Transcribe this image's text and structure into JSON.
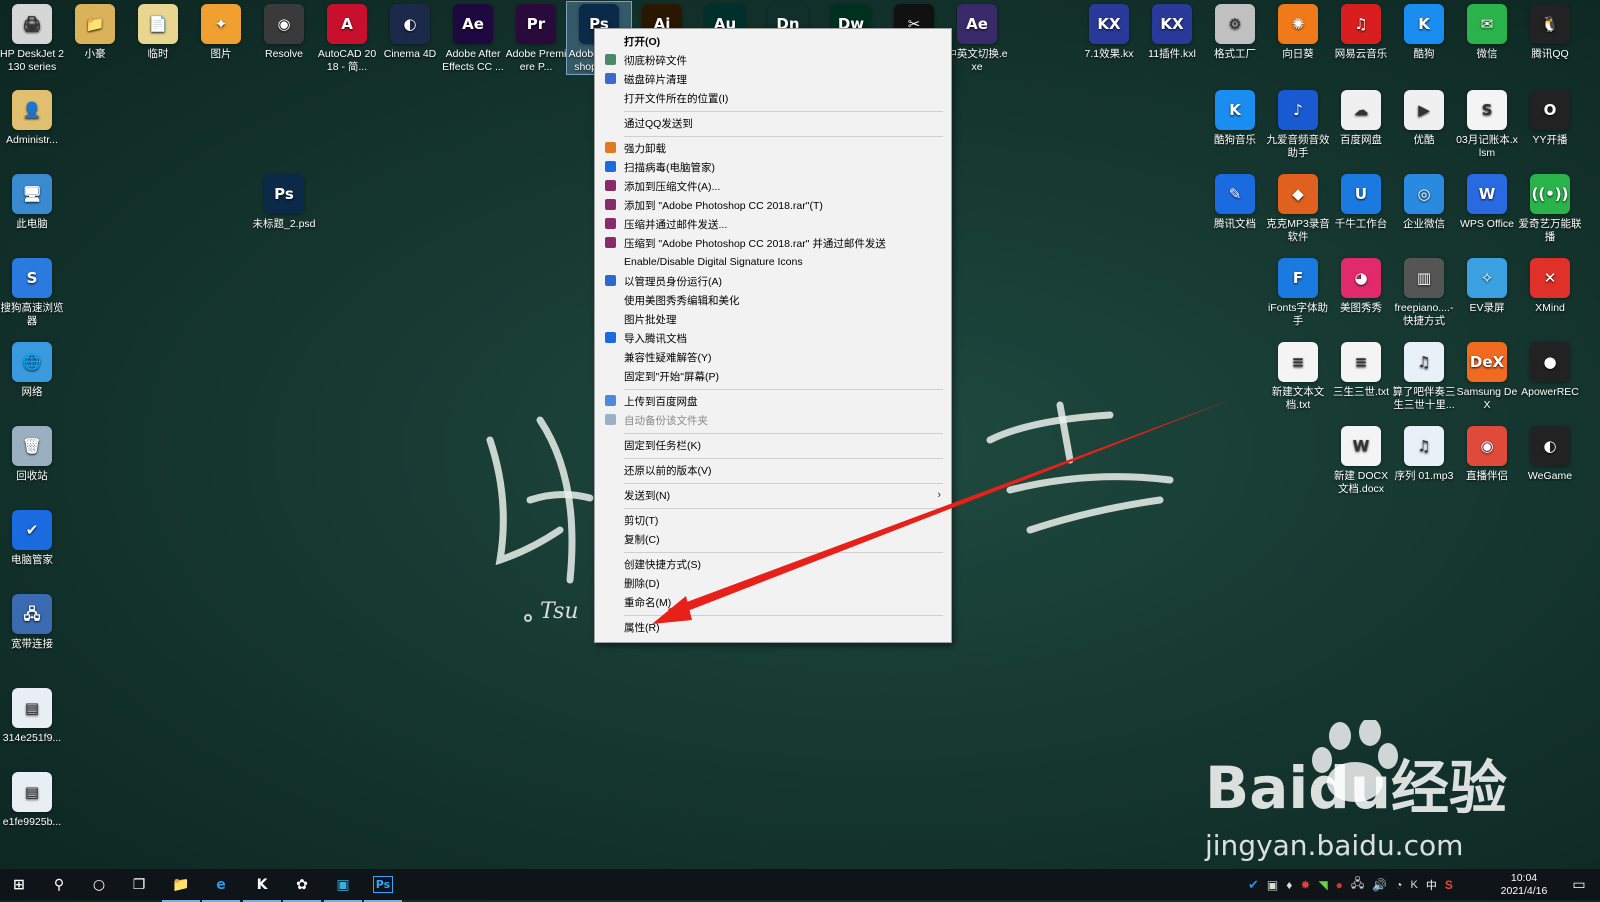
{
  "desktop": {
    "top_row": [
      {
        "name": "hp-deskjet",
        "label": "HP DeskJet 2130 series",
        "color": "#d6d6d6",
        "glyph": "🖨",
        "icon": "printer-icon"
      },
      {
        "name": "xiaohao",
        "label": "小豪",
        "color": "#d9b25a",
        "glyph": "📁",
        "icon": "folder-icon"
      },
      {
        "name": "linshi",
        "label": "临时",
        "color": "#e8d590",
        "glyph": "📄",
        "icon": "file-icon"
      },
      {
        "name": "pictures",
        "label": "图片",
        "color": "#f0a030",
        "glyph": "✦",
        "icon": "pinwheel-icon"
      },
      {
        "name": "resolve",
        "label": "Resolve",
        "color": "#3a3a3a",
        "glyph": "◉",
        "icon": "davinci-icon"
      },
      {
        "name": "autocad",
        "label": "AutoCAD 2018 - 简...",
        "color": "#c8102e",
        "glyph": "A",
        "icon": "autocad-icon"
      },
      {
        "name": "cinema4d",
        "label": "Cinema 4D",
        "color": "#1b2a4a",
        "glyph": "◐",
        "icon": "cinema4d-icon"
      },
      {
        "name": "after-effects",
        "label": "Adobe After Effects CC ...",
        "color": "#1f0740",
        "glyph": "Ae",
        "icon": "after-effects-icon"
      },
      {
        "name": "premiere",
        "label": "Adobe Premiere P...",
        "color": "#2a0a3a",
        "glyph": "Pr",
        "icon": "premiere-icon"
      },
      {
        "name": "photoshop",
        "label": "Adobe Photoshop CC...",
        "color": "#0b2a4a",
        "glyph": "Ps",
        "icon": "photoshop-icon"
      },
      {
        "name": "illustrator",
        "label": "",
        "color": "#2b1600",
        "glyph": "Ai",
        "icon": "illustrator-icon"
      },
      {
        "name": "audition",
        "label": "",
        "color": "#00302c",
        "glyph": "Au",
        "icon": "audition-icon"
      },
      {
        "name": "dimension",
        "label": "",
        "color": "#10302c",
        "glyph": "Dn",
        "icon": "dimension-icon"
      },
      {
        "name": "dreamweaver",
        "label": "",
        "color": "#003020",
        "glyph": "Dw",
        "icon": "dreamweaver-icon"
      },
      {
        "name": "capcut",
        "label": "",
        "color": "#111111",
        "glyph": "✂",
        "icon": "capcut-icon"
      },
      {
        "name": "cn-en-switch",
        "label": "中英文切换.exe",
        "color": "#3a2a6a",
        "glyph": "Ae",
        "icon": "switch-exe-icon"
      },
      {
        "name": "kx-71",
        "label": "7.1效果.kx",
        "color": "#2a3a9a",
        "glyph": "KX",
        "icon": "kx-file-icon"
      },
      {
        "name": "kx-11",
        "label": "11插件.kxl",
        "color": "#2a3a9a",
        "glyph": "KX",
        "icon": "kx-plugin-icon"
      },
      {
        "name": "format-factory",
        "label": "格式工厂",
        "color": "#c0c0c0",
        "glyph": "⚙",
        "icon": "format-factory-icon"
      },
      {
        "name": "sunflower",
        "label": "向日葵",
        "color": "#f07a1a",
        "glyph": "✺",
        "icon": "sunflower-icon"
      },
      {
        "name": "netease-music",
        "label": "网易云音乐",
        "color": "#d81e1e",
        "glyph": "♫",
        "icon": "netease-music-icon"
      },
      {
        "name": "kugou",
        "label": "酷狗",
        "color": "#1a8ef0",
        "glyph": "K",
        "icon": "kugou-icon"
      },
      {
        "name": "wechat",
        "label": "微信",
        "color": "#2ab34a",
        "glyph": "✉",
        "icon": "wechat-icon"
      },
      {
        "name": "tencent-qq",
        "label": "腾讯QQ",
        "color": "#222222",
        "glyph": "🐧",
        "icon": "qq-icon"
      }
    ],
    "left_column": [
      {
        "name": "administrator",
        "label": "Administr...",
        "color": "#e0c070",
        "glyph": "👤",
        "icon": "user-folder-icon"
      },
      {
        "name": "this-pc",
        "label": "此电脑",
        "color": "#3a8ad0",
        "glyph": "🖥",
        "icon": "computer-icon"
      },
      {
        "name": "sogou-browser",
        "label": "搜狗高速浏览器",
        "color": "#2a7ae0",
        "glyph": "S",
        "icon": "sogou-browser-icon"
      },
      {
        "name": "network",
        "label": "网络",
        "color": "#3a9ae0",
        "glyph": "🌐",
        "icon": "network-icon"
      },
      {
        "name": "recycle-bin",
        "label": "回收站",
        "color": "#9ab0c0",
        "glyph": "🗑",
        "icon": "recycle-bin-icon"
      },
      {
        "name": "pc-manager",
        "label": "电脑管家",
        "color": "#1a6ae0",
        "glyph": "✔",
        "icon": "pc-manager-icon"
      },
      {
        "name": "broadband",
        "label": "宽带连接",
        "color": "#3a6ab0",
        "glyph": "🖧",
        "icon": "broadband-icon"
      },
      {
        "name": "img-314e",
        "label": "314e251f9...",
        "color": "#e8eef4",
        "glyph": "▤",
        "icon": "image-file-icon"
      },
      {
        "name": "img-e1fe",
        "label": "e1fe9925b...",
        "color": "#e8eef4",
        "glyph": "▤",
        "icon": "image-file-icon"
      }
    ],
    "psd_file": {
      "name": "untitled-psd",
      "label": "未标题_2.psd",
      "color": "#0b2a4a",
      "glyph": "Ps",
      "icon": "psd-file-icon"
    },
    "right_grid": [
      {
        "name": "kugou-music",
        "label": "酷狗音乐",
        "color": "#1a8ef0",
        "glyph": "K",
        "icon": "kugou-music-icon"
      },
      {
        "name": "jiuai",
        "label": "九爱音频音效助手",
        "color": "#1a5ad0",
        "glyph": "♪",
        "icon": "audio-helper-icon"
      },
      {
        "name": "baidu-netdisk",
        "label": "百度网盘",
        "color": "#f0f0f0",
        "glyph": "☁",
        "icon": "baidu-netdisk-icon"
      },
      {
        "name": "youku",
        "label": "优酷",
        "color": "#f0f0f0",
        "glyph": "▶",
        "icon": "youku-icon"
      },
      {
        "name": "xlsm",
        "label": "03月记账本.xlsm",
        "color": "#f4f4f4",
        "glyph": "S",
        "icon": "spreadsheet-icon"
      },
      {
        "name": "yy",
        "label": "YY开播",
        "color": "#222222",
        "glyph": "O",
        "icon": "yy-icon"
      },
      {
        "name": "tencent-docs",
        "label": "腾讯文档",
        "color": "#1a6ae0",
        "glyph": "✎",
        "icon": "tencent-docs-icon"
      },
      {
        "name": "mp3-recorder",
        "label": "克克MP3录音软件",
        "color": "#e06020",
        "glyph": "◆",
        "icon": "mp3-recorder-icon"
      },
      {
        "name": "qianniu",
        "label": "千牛工作台",
        "color": "#1a7ae0",
        "glyph": "U",
        "icon": "qianniu-icon"
      },
      {
        "name": "wecom",
        "label": "企业微信",
        "color": "#2a8ae0",
        "glyph": "◎",
        "icon": "wecom-icon"
      },
      {
        "name": "wps",
        "label": "WPS Office",
        "color": "#2a6ae0",
        "glyph": "W",
        "icon": "wps-icon"
      },
      {
        "name": "aiqiyi",
        "label": "爱奇艺万能联播",
        "color": "#2ab34a",
        "glyph": "((•))",
        "icon": "iqiyi-icon"
      },
      {
        "name": "ifonts",
        "label": "iFonts字体助手",
        "color": "#1a7ae0",
        "glyph": "F",
        "icon": "ifonts-icon"
      },
      {
        "name": "meitu",
        "label": "美图秀秀",
        "color": "#e02a6a",
        "glyph": "◕",
        "icon": "meitu-icon"
      },
      {
        "name": "freepiano",
        "label": "freepiano....- 快捷方式",
        "color": "#555555",
        "glyph": "▥",
        "icon": "piano-icon"
      },
      {
        "name": "ev-recorder",
        "label": "EV录屏",
        "color": "#3aa0e0",
        "glyph": "✧",
        "icon": "ev-recorder-icon"
      },
      {
        "name": "xmind",
        "label": "XMind",
        "color": "#e0302a",
        "glyph": "✕",
        "icon": "xmind-icon"
      },
      {
        "name": "new-txt",
        "label": "新建文本文档.txt",
        "color": "#f4f4f4",
        "glyph": "≡",
        "icon": "text-file-icon"
      },
      {
        "name": "sansheng-txt",
        "label": "三生三世.txt",
        "color": "#f4f4f4",
        "glyph": "≡",
        "icon": "text-file-icon"
      },
      {
        "name": "mp3-1",
        "label": "算了吧伴奏三生三世十里...",
        "color": "#e8f0f8",
        "glyph": "♫",
        "icon": "mp3-file-icon"
      },
      {
        "name": "samsung-dex",
        "label": "Samsung DeX",
        "color": "#f06a20",
        "glyph": "DeX",
        "icon": "samsung-dex-icon"
      },
      {
        "name": "apowerrec",
        "label": "ApowerREC",
        "color": "#222222",
        "glyph": "●",
        "icon": "apowerrec-icon"
      },
      {
        "name": "new-docx",
        "label": "新建 DOCX 文档.docx",
        "color": "#f4f4f4",
        "glyph": "W",
        "icon": "docx-file-icon"
      },
      {
        "name": "mp3-2",
        "label": "序列 01.mp3",
        "color": "#e8f0f8",
        "glyph": "♫",
        "icon": "mp3-file-icon"
      },
      {
        "name": "live-helper",
        "label": "直播伴侣",
        "color": "#e04a3a",
        "glyph": "◉",
        "icon": "live-helper-icon"
      },
      {
        "name": "wegame",
        "label": "WeGame",
        "color": "#222222",
        "glyph": "◐",
        "icon": "wegame-icon"
      }
    ]
  },
  "chalk_text": "Tsu",
  "watermark": {
    "main": "Baidu经验",
    "url": "jingyan.baidu.com"
  },
  "context_menu": {
    "items": [
      {
        "label": "打开(O)",
        "bold": true,
        "icon": ""
      },
      {
        "label": "彻底粉碎文件",
        "icon": "shredder-icon",
        "color": "#4a8a6a"
      },
      {
        "label": "磁盘碎片清理",
        "icon": "disk-cleanup-icon",
        "color": "#3a6ad0"
      },
      {
        "label": "打开文件所在的位置(I)",
        "icon": ""
      },
      {
        "sep": true
      },
      {
        "label": "通过QQ发送到",
        "icon": ""
      },
      {
        "sep": true
      },
      {
        "label": "强力卸载",
        "icon": "uninstall-icon",
        "color": "#e07a20"
      },
      {
        "label": "扫描病毒(电脑管家)",
        "icon": "shield-icon",
        "color": "#1a6ae0"
      },
      {
        "label": "添加到压缩文件(A)...",
        "icon": "winrar-icon",
        "color": "#8a2a6a"
      },
      {
        "label": "添加到 \"Adobe Photoshop CC 2018.rar\"(T)",
        "icon": "winrar-icon",
        "color": "#8a2a6a"
      },
      {
        "label": "压缩并通过邮件发送...",
        "icon": "winrar-icon",
        "color": "#8a2a6a"
      },
      {
        "label": "压缩到 \"Adobe Photoshop CC 2018.rar\" 并通过邮件发送",
        "icon": "winrar-icon",
        "color": "#8a2a6a"
      },
      {
        "label": "Enable/Disable Digital Signature Icons",
        "icon": ""
      },
      {
        "label": "以管理员身份运行(A)",
        "icon": "uac-shield-icon",
        "color": "#2a6ad0"
      },
      {
        "label": "使用美图秀秀编辑和美化",
        "icon": ""
      },
      {
        "label": "图片批处理",
        "icon": ""
      },
      {
        "label": "导入腾讯文档",
        "icon": "tencent-docs-icon",
        "color": "#1a6ae0"
      },
      {
        "label": "兼容性疑难解答(Y)",
        "icon": ""
      },
      {
        "label": "固定到\"开始\"屏幕(P)",
        "icon": ""
      },
      {
        "sep": true
      },
      {
        "label": "上传到百度网盘",
        "icon": "cloud-icon",
        "color": "#4a8ae0"
      },
      {
        "label": "自动备份该文件夹",
        "icon": "cloud-icon",
        "color": "#9ab0c8",
        "disabled": true
      },
      {
        "sep": true
      },
      {
        "label": "固定到任务栏(K)",
        "icon": ""
      },
      {
        "sep": true
      },
      {
        "label": "还原以前的版本(V)",
        "icon": ""
      },
      {
        "sep": true
      },
      {
        "label": "发送到(N)",
        "icon": "",
        "submenu": true
      },
      {
        "sep": true
      },
      {
        "label": "剪切(T)",
        "icon": ""
      },
      {
        "label": "复制(C)",
        "icon": ""
      },
      {
        "sep": true
      },
      {
        "label": "创建快捷方式(S)",
        "icon": ""
      },
      {
        "label": "删除(D)",
        "icon": ""
      },
      {
        "label": "重命名(M)",
        "icon": ""
      },
      {
        "sep": true
      },
      {
        "label": "属性(R)",
        "icon": ""
      }
    ]
  },
  "taskbar": {
    "apps": [
      {
        "name": "start-button",
        "glyph": "⊞",
        "icon": "windows-start-icon"
      },
      {
        "name": "search-button",
        "glyph": "⚲",
        "icon": "search-icon"
      },
      {
        "name": "cortana-button",
        "glyph": "○",
        "icon": "cortana-icon"
      },
      {
        "name": "task-view-button",
        "glyph": "❐",
        "icon": "task-view-icon"
      },
      {
        "name": "file-explorer",
        "glyph": "📁",
        "icon": "file-explorer-icon"
      },
      {
        "name": "edge-browser",
        "glyph": "e",
        "icon": "edge-icon"
      },
      {
        "name": "kx-app",
        "glyph": "K",
        "icon": "kx-app-icon"
      },
      {
        "name": "baidu-app",
        "glyph": "✿",
        "icon": "baidu-icon"
      },
      {
        "name": "screenshot-app",
        "glyph": "▣",
        "icon": "screenshot-icon"
      },
      {
        "name": "photoshop-app",
        "glyph": "Ps",
        "icon": "photoshop-icon"
      }
    ],
    "ime": "中",
    "time": "10:04",
    "date": "2021/4/16"
  },
  "colors": {
    "arrow": "#e8201a",
    "menu_bg": "#f2f2f2",
    "desktop": "#173e35"
  }
}
